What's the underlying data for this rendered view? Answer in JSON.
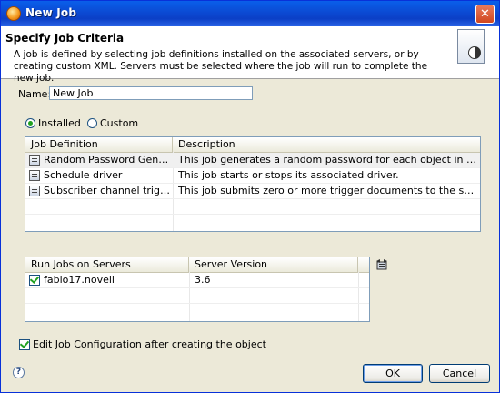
{
  "window": {
    "title": "New Job",
    "close_glyph": "✕"
  },
  "header": {
    "title": "Specify Job Criteria",
    "description": "A job is defined by selecting job definitions installed on the associated servers, or by creating custom XML. Servers must be selected where the job will run to complete the new job."
  },
  "name_field": {
    "label": "Name:",
    "value": "New Job"
  },
  "source": {
    "selected": "Installed",
    "options": [
      "Installed",
      "Custom"
    ]
  },
  "job_table": {
    "columns": [
      "Job Definition",
      "Description"
    ],
    "rows": [
      {
        "definition": "Random Password Generator",
        "description": "This job generates a random password for each object in scope, accordi..."
      },
      {
        "definition": "Schedule driver",
        "description": "This job starts or stops its associated driver."
      },
      {
        "definition": "Subscriber channel trigger",
        "description": "This job submits zero or more trigger documents to the subscriber chann..."
      }
    ]
  },
  "server_table": {
    "columns": [
      "Run Jobs on Servers",
      "Server Version"
    ],
    "rows": [
      {
        "checked": true,
        "server": "fabio17.novell",
        "version": "3.6"
      }
    ]
  },
  "edit_config": {
    "checked": true,
    "label": "Edit Job Configuration after creating the object"
  },
  "buttons": {
    "ok": "OK",
    "cancel": "Cancel"
  },
  "help_glyph": "?",
  "icons": {
    "app": "novell-app-icon",
    "header": "job-document-icon",
    "row": "job-definition-icon",
    "refresh": "refresh-servers-icon"
  }
}
